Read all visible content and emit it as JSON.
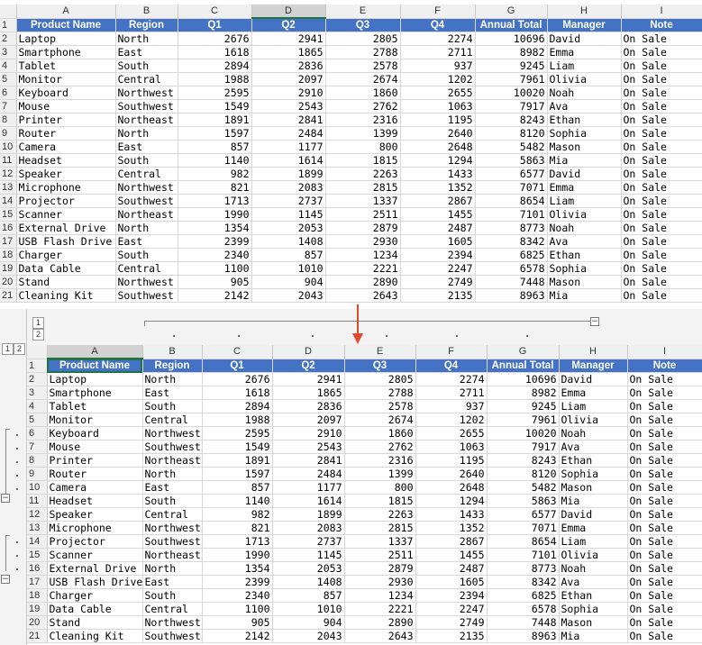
{
  "columns": [
    "A",
    "B",
    "C",
    "D",
    "E",
    "F",
    "G",
    "H",
    "I"
  ],
  "headers": [
    "Product Name",
    "Region",
    "Q1",
    "Q2",
    "Q3",
    "Q4",
    "Annual Total",
    "Manager",
    "Note"
  ],
  "rows": [
    [
      "Laptop",
      "North",
      "2676",
      "2941",
      "2805",
      "2274",
      "10696",
      "David",
      "On Sale"
    ],
    [
      "Smartphone",
      "East",
      "1618",
      "1865",
      "2788",
      "2711",
      "8982",
      "Emma",
      "On Sale"
    ],
    [
      "Tablet",
      "South",
      "2894",
      "2836",
      "2578",
      "937",
      "9245",
      "Liam",
      "On Sale"
    ],
    [
      "Monitor",
      "Central",
      "1988",
      "2097",
      "2674",
      "1202",
      "7961",
      "Olivia",
      "On Sale"
    ],
    [
      "Keyboard",
      "Northwest",
      "2595",
      "2910",
      "1860",
      "2655",
      "10020",
      "Noah",
      "On Sale"
    ],
    [
      "Mouse",
      "Southwest",
      "1549",
      "2543",
      "2762",
      "1063",
      "7917",
      "Ava",
      "On Sale"
    ],
    [
      "Printer",
      "Northeast",
      "1891",
      "2841",
      "2316",
      "1195",
      "8243",
      "Ethan",
      "On Sale"
    ],
    [
      "Router",
      "North",
      "1597",
      "2484",
      "1399",
      "2640",
      "8120",
      "Sophia",
      "On Sale"
    ],
    [
      "Camera",
      "East",
      "857",
      "1177",
      "800",
      "2648",
      "5482",
      "Mason",
      "On Sale"
    ],
    [
      "Headset",
      "South",
      "1140",
      "1614",
      "1815",
      "1294",
      "5863",
      "Mia",
      "On Sale"
    ],
    [
      "Speaker",
      "Central",
      "982",
      "1899",
      "2263",
      "1433",
      "6577",
      "David",
      "On Sale"
    ],
    [
      "Microphone",
      "Northwest",
      "821",
      "2083",
      "2815",
      "1352",
      "7071",
      "Emma",
      "On Sale"
    ],
    [
      "Projector",
      "Southwest",
      "1713",
      "2737",
      "1337",
      "2867",
      "8654",
      "Liam",
      "On Sale"
    ],
    [
      "Scanner",
      "Northeast",
      "1990",
      "1145",
      "2511",
      "1455",
      "7101",
      "Olivia",
      "On Sale"
    ],
    [
      "External Drive",
      "North",
      "1354",
      "2053",
      "2879",
      "2487",
      "8773",
      "Noah",
      "On Sale"
    ],
    [
      "USB Flash Drive",
      "East",
      "2399",
      "1408",
      "2930",
      "1605",
      "8342",
      "Ava",
      "On Sale"
    ],
    [
      "Charger",
      "South",
      "2340",
      "857",
      "1234",
      "2394",
      "6825",
      "Ethan",
      "On Sale"
    ],
    [
      "Data Cable",
      "Central",
      "1100",
      "1010",
      "2221",
      "2247",
      "6578",
      "Sophia",
      "On Sale"
    ],
    [
      "Stand",
      "Northwest",
      "905",
      "904",
      "2890",
      "2749",
      "7448",
      "Mason",
      "On Sale"
    ],
    [
      "Cleaning Kit",
      "Southwest",
      "2142",
      "2043",
      "2643",
      "2135",
      "8963",
      "Mia",
      "On Sale"
    ]
  ],
  "outline": {
    "row_levels": [
      "1",
      "2"
    ],
    "col_levels": [
      "1",
      "2"
    ],
    "collapse_glyph": "−"
  },
  "colors": {
    "header_fill": "#4472c4",
    "arrow": "#e04a2c",
    "selection": "#217346"
  }
}
